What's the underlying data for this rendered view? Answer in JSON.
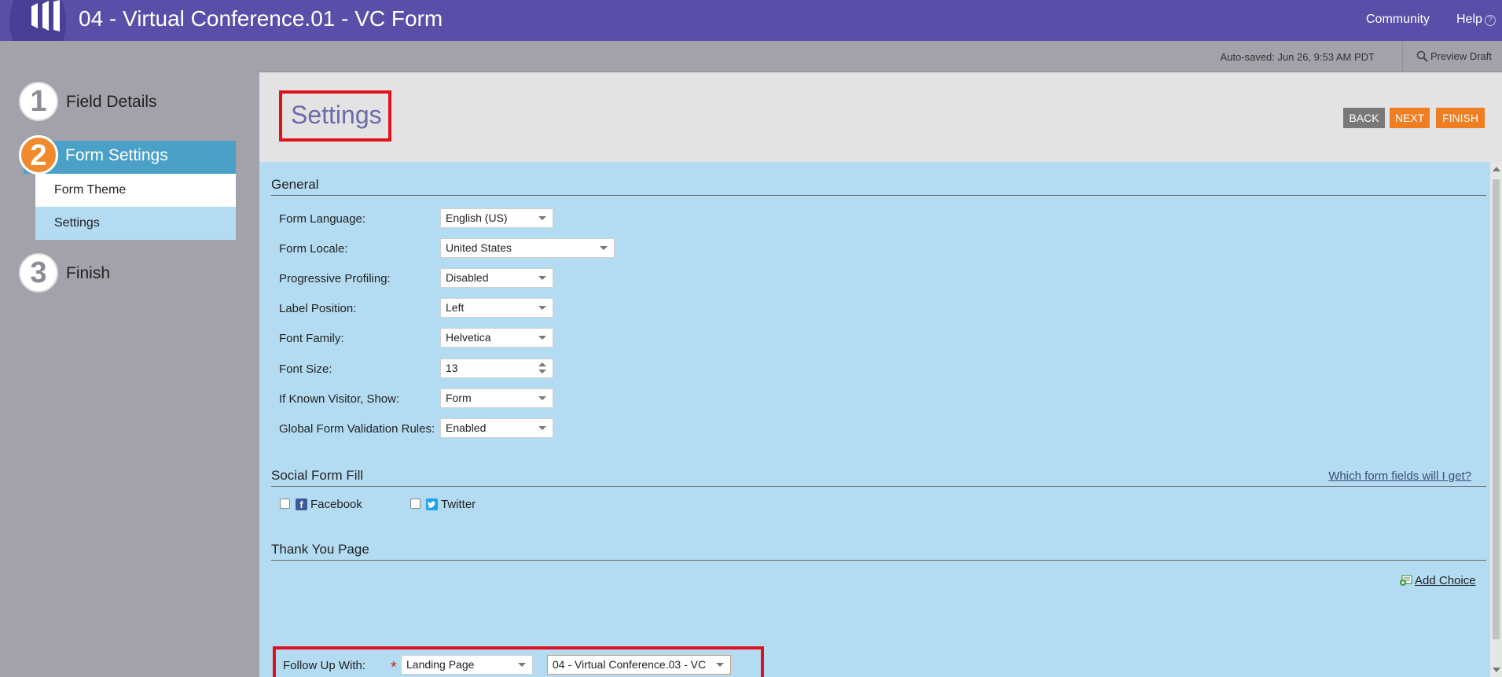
{
  "header": {
    "title": "04 - Virtual Conference.01 - VC Form",
    "community": "Community",
    "help": "Help",
    "help_icon_glyph": "?"
  },
  "sidebar": {
    "steps": [
      {
        "number": "1",
        "label": "Field Details"
      },
      {
        "number": "2",
        "label": "Form Settings"
      },
      {
        "number": "3",
        "label": "Finish"
      }
    ],
    "substeps": [
      {
        "label": "Form Theme"
      },
      {
        "label": "Settings"
      }
    ]
  },
  "toolbar": {
    "autosaved": "Auto-saved: Jun 26, 9:53 AM PDT",
    "preview": "Preview Draft"
  },
  "page": {
    "title": "Settings",
    "back": "BACK",
    "next": "NEXT",
    "finish": "FINISH"
  },
  "general": {
    "title": "General",
    "fields": [
      {
        "label": "Form Language:",
        "value": "English (US)"
      },
      {
        "label": "Form Locale:",
        "value": "United States"
      },
      {
        "label": "Progressive Profiling:",
        "value": "Disabled"
      },
      {
        "label": "Label Position:",
        "value": "Left"
      },
      {
        "label": "Font Family:",
        "value": "Helvetica"
      },
      {
        "label": "Font Size:",
        "value": "13"
      },
      {
        "label": "If Known Visitor, Show:",
        "value": "Form"
      },
      {
        "label": "Global Form Validation Rules:",
        "value": "Enabled"
      }
    ]
  },
  "social": {
    "title": "Social Form Fill",
    "link": "Which form fields will I get?",
    "facebook": "Facebook",
    "facebook_glyph": "f",
    "twitter": "Twitter",
    "facebook_checked": false,
    "twitter_checked": false
  },
  "thankyou": {
    "title": "Thank You Page",
    "add_choice": "Add Choice",
    "follow_label": "Follow Up With:",
    "required_mark": "*",
    "follow_type": "Landing Page",
    "follow_target": "04 - Virtual Conference.03 - VC"
  },
  "colors": {
    "header_bg": "#5a4fa8",
    "sidebar_bg": "#a3a1a9",
    "active_step": "#4ba0c8",
    "step_badge": "#f08a2c",
    "content_bg": "#b3dcf2",
    "primary_btn": "#ef7d22",
    "highlight": "#e0101e"
  }
}
